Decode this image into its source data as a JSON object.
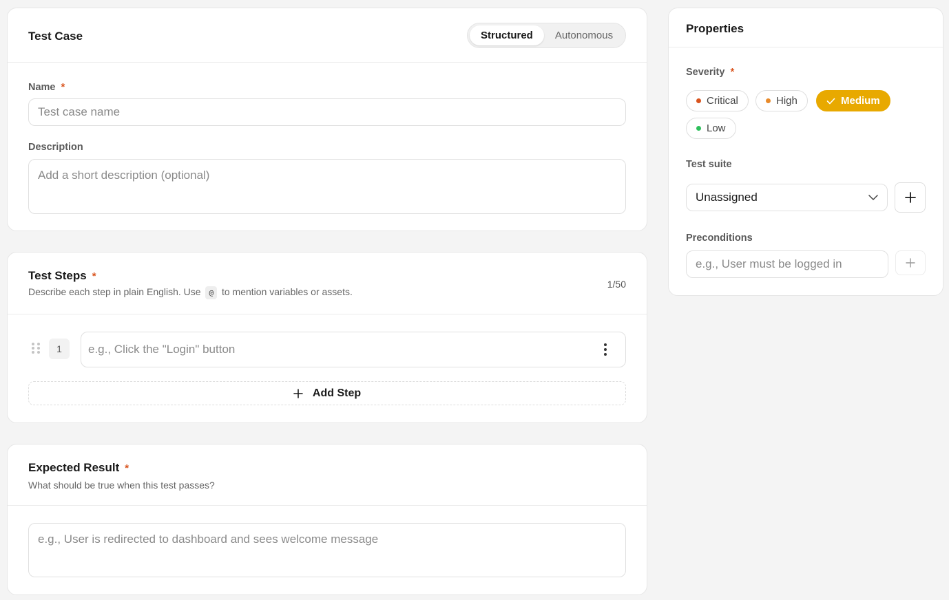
{
  "test_case": {
    "title": "Test Case",
    "modes": [
      "Structured",
      "Autonomous"
    ],
    "name_label": "Name",
    "required_mark": "*",
    "name_placeholder": "Test case name",
    "description_label": "Description",
    "description_placeholder": "Add a short description (optional)"
  },
  "test_steps": {
    "title": "Test Steps",
    "required_mark": "*",
    "subtitle_before": "Describe each step in plain English. Use",
    "mention_token": "@",
    "subtitle_after": "to mention variables or assets.",
    "counter": "1/50",
    "steps": [
      {
        "number": "1",
        "placeholder": "e.g., Click the \"Login\" button"
      }
    ],
    "add_step_label": "Add Step"
  },
  "expected_result": {
    "title": "Expected Result",
    "required_mark": "*",
    "subtitle": "What should be true when this test passes?",
    "placeholder": "e.g., User is redirected to dashboard and sees welcome message"
  },
  "properties": {
    "title": "Properties",
    "severity_label": "Severity",
    "required_mark": "*",
    "severities": [
      {
        "label": "Critical",
        "color": "#d9541e"
      },
      {
        "label": "High",
        "color": "#e88a2a"
      },
      {
        "label": "Medium",
        "color": "#e8a900",
        "selected": true
      },
      {
        "label": "Low",
        "color": "#2ebf5b"
      }
    ],
    "test_suite_label": "Test suite",
    "test_suite_value": "Unassigned",
    "preconditions_label": "Preconditions",
    "preconditions_placeholder": "e.g., User must be logged in"
  },
  "colors": {
    "accent": "#e8a900",
    "required": "#d9541e"
  }
}
